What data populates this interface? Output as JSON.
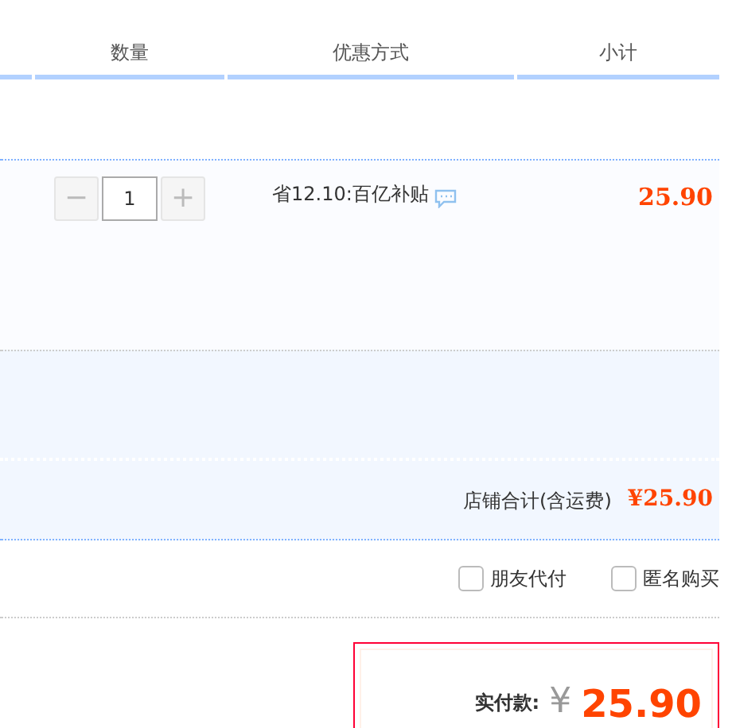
{
  "table": {
    "columns": [
      {
        "label": "数量"
      },
      {
        "label": "优惠方式"
      },
      {
        "label": "小计"
      }
    ]
  },
  "item": {
    "quantity": "1",
    "minus": "−",
    "plus": "+",
    "discount": "省12.10:百亿补贴",
    "subtotal": "25.90"
  },
  "store_total": {
    "label": "店铺合计(含运费)",
    "amount": "¥25.90"
  },
  "options": [
    {
      "label": "朋友代付",
      "checked": false
    },
    {
      "label": "匿名购买",
      "checked": false
    }
  ],
  "payment": {
    "label": "实付款:",
    "currency": "¥",
    "amount": "25.90"
  }
}
